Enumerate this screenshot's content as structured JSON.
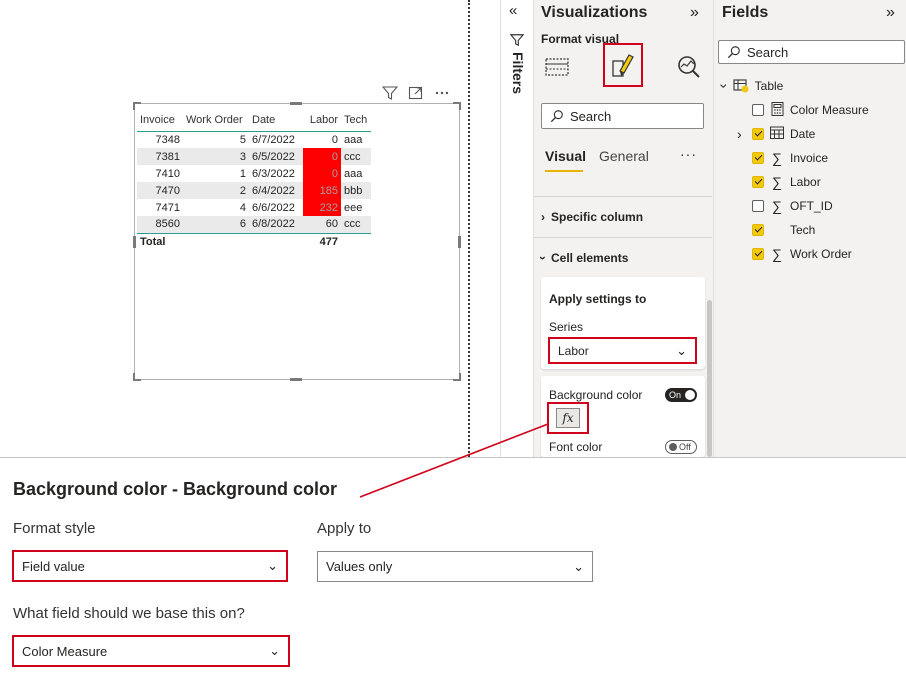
{
  "table": {
    "columns": [
      "Invoice",
      "Work Order",
      "Date",
      "Labor",
      "Tech"
    ],
    "rows": [
      {
        "invoice": "7348",
        "work_order": "5",
        "date": "6/7/2022",
        "labor": "0",
        "tech": "aaa",
        "red": false
      },
      {
        "invoice": "7381",
        "work_order": "3",
        "date": "6/5/2022",
        "labor": "0",
        "tech": "ccc",
        "red": true
      },
      {
        "invoice": "7410",
        "work_order": "1",
        "date": "6/3/2022",
        "labor": "0",
        "tech": "aaa",
        "red": true
      },
      {
        "invoice": "7470",
        "work_order": "2",
        "date": "6/4/2022",
        "labor": "185",
        "tech": "bbb",
        "red": true
      },
      {
        "invoice": "7471",
        "work_order": "4",
        "date": "6/6/2022",
        "labor": "232",
        "tech": "eee",
        "red": true
      },
      {
        "invoice": "8560",
        "work_order": "6",
        "date": "6/8/2022",
        "labor": "60",
        "tech": "ccc",
        "red": false
      }
    ],
    "total_label": "Total",
    "total_labor": "477",
    "highlight_color": "#ff0000"
  },
  "visual_header": {
    "icons": [
      "filter-icon",
      "focus-mode-icon",
      "more-options-icon"
    ]
  },
  "filters": {
    "label": "Filters",
    "collapse_icon": "chevron-double-left-icon"
  },
  "viz": {
    "title": "Visualizations",
    "subtitle": "Format visual",
    "search_placeholder": "Search",
    "tabs": [
      "Visual",
      "General"
    ],
    "more": "···",
    "sections": {
      "specific_column": "Specific column",
      "cell_elements": "Cell elements"
    },
    "apply_settings_to": "Apply settings to",
    "series_label": "Series",
    "series_value": "Labor",
    "background_color_label": "Background color",
    "background_toggle": "On",
    "fx": "fx",
    "font_color_label": "Font color",
    "font_toggle": "Off"
  },
  "fields": {
    "title": "Fields",
    "search_placeholder": "Search",
    "table_name": "Table",
    "items": [
      {
        "name": "Color Measure",
        "checked": false,
        "type": "calculator-icon"
      },
      {
        "name": "Date",
        "checked": true,
        "type": "calendar-icon"
      },
      {
        "name": "Invoice",
        "checked": true,
        "type": "sigma-icon"
      },
      {
        "name": "Labor",
        "checked": true,
        "type": "sigma-icon"
      },
      {
        "name": "OFT_ID",
        "checked": false,
        "type": "sigma-icon"
      },
      {
        "name": "Tech",
        "checked": true,
        "type": "none"
      },
      {
        "name": "Work Order",
        "checked": true,
        "type": "sigma-icon"
      }
    ]
  },
  "dialog": {
    "title": "Background color - Background color",
    "format_style_label": "Format style",
    "format_style_value": "Field value",
    "apply_to_label": "Apply to",
    "apply_to_value": "Values only",
    "base_field_label": "What field should we base this on?",
    "base_field_value": "Color Measure"
  },
  "colors": {
    "accent": "#f2c811",
    "annotation_red": "#d0021b"
  }
}
